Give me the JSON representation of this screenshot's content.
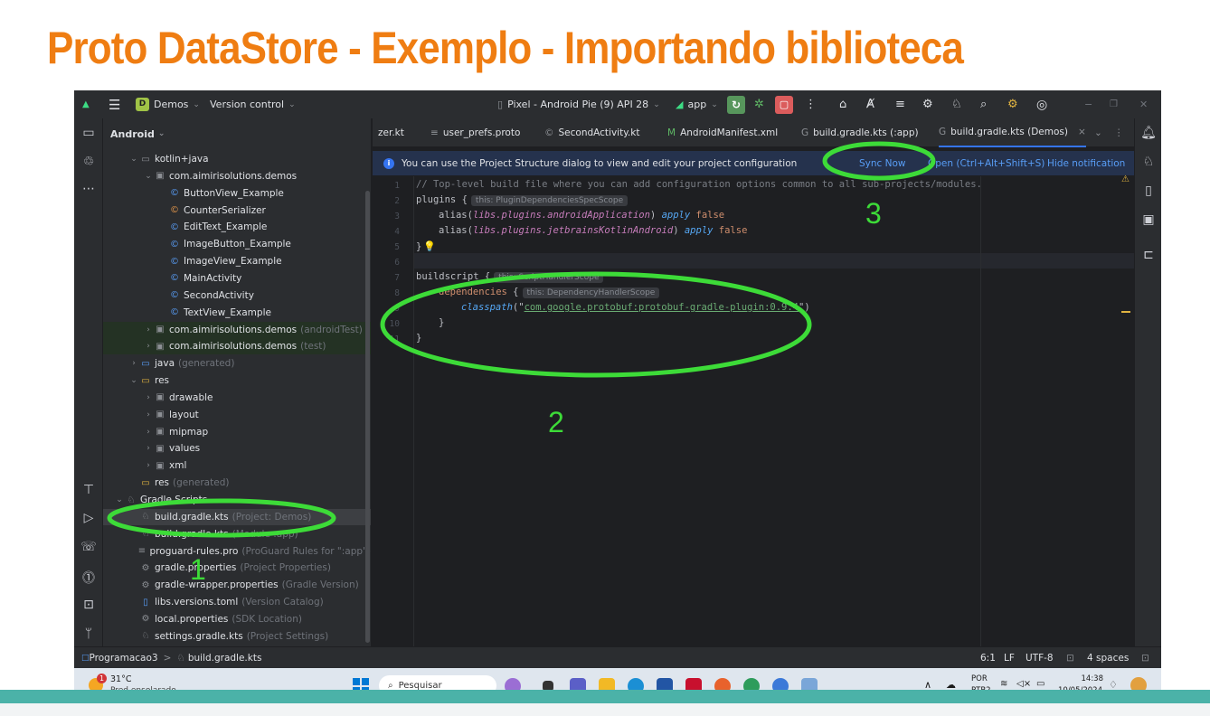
{
  "slide": {
    "title": "Proto DataStore - Exemplo - Importando biblioteca"
  },
  "titlebar": {
    "project_badge": "D",
    "project_name": "Demos",
    "version_control": "Version control",
    "device": "Pixel - Android Pie (9) API 28",
    "run_config": "app"
  },
  "project_panel": {
    "view_mode": "Android",
    "items": [
      {
        "arrow": "⌄",
        "icon": "folder",
        "label": "kotlin+java",
        "suffix": ""
      },
      {
        "arrow": "⌄",
        "icon": "package",
        "label": "com.aimirisolutions.demos",
        "suffix": ""
      },
      {
        "arrow": "",
        "icon": "class",
        "label": "ButtonView_Example",
        "suffix": ""
      },
      {
        "arrow": "",
        "icon": "class-orange",
        "label": "CounterSerializer",
        "suffix": ""
      },
      {
        "arrow": "",
        "icon": "class",
        "label": "EditText_Example",
        "suffix": ""
      },
      {
        "arrow": "",
        "icon": "class",
        "label": "ImageButton_Example",
        "suffix": ""
      },
      {
        "arrow": "",
        "icon": "class",
        "label": "ImageView_Example",
        "suffix": ""
      },
      {
        "arrow": "",
        "icon": "class",
        "label": "MainActivity",
        "suffix": ""
      },
      {
        "arrow": "",
        "icon": "class",
        "label": "SecondActivity",
        "suffix": ""
      },
      {
        "arrow": "",
        "icon": "class",
        "label": "TextView_Example",
        "suffix": ""
      },
      {
        "arrow": "›",
        "icon": "package",
        "label": "com.aimirisolutions.demos",
        "suffix": "(androidTest)"
      },
      {
        "arrow": "›",
        "icon": "package",
        "label": "com.aimirisolutions.demos",
        "suffix": "(test)"
      },
      {
        "arrow": "›",
        "icon": "folder-gen",
        "label": "java",
        "suffix": "(generated)"
      },
      {
        "arrow": "⌄",
        "icon": "folder-res",
        "label": "res",
        "suffix": ""
      },
      {
        "arrow": "›",
        "icon": "package",
        "label": "drawable",
        "suffix": ""
      },
      {
        "arrow": "›",
        "icon": "package",
        "label": "layout",
        "suffix": ""
      },
      {
        "arrow": "›",
        "icon": "package",
        "label": "mipmap",
        "suffix": ""
      },
      {
        "arrow": "›",
        "icon": "package",
        "label": "values",
        "suffix": ""
      },
      {
        "arrow": "›",
        "icon": "package",
        "label": "xml",
        "suffix": ""
      },
      {
        "arrow": "",
        "icon": "folder-res",
        "label": "res",
        "suffix": "(generated)"
      },
      {
        "arrow": "⌄",
        "icon": "gradle",
        "label": "Gradle Scripts",
        "suffix": ""
      },
      {
        "arrow": "",
        "icon": "gradle",
        "label": "build.gradle.kts",
        "suffix": "(Project: Demos)"
      },
      {
        "arrow": "",
        "icon": "gradle",
        "label": "build.gradle.kts",
        "suffix": "(Module :app)"
      },
      {
        "arrow": "",
        "icon": "text",
        "label": "proguard-rules.pro",
        "suffix": "(ProGuard Rules for \":app\")"
      },
      {
        "arrow": "",
        "icon": "settings",
        "label": "gradle.properties",
        "suffix": "(Project Properties)"
      },
      {
        "arrow": "",
        "icon": "settings",
        "label": "gradle-wrapper.properties",
        "suffix": "(Gradle Version)"
      },
      {
        "arrow": "",
        "icon": "toml",
        "label": "libs.versions.toml",
        "suffix": "(Version Catalog)"
      },
      {
        "arrow": "",
        "icon": "settings",
        "label": "local.properties",
        "suffix": "(SDK Location)"
      },
      {
        "arrow": "",
        "icon": "gradle",
        "label": "settings.gradle.kts",
        "suffix": "(Project Settings)"
      }
    ]
  },
  "tabs": [
    {
      "label": "zer.kt",
      "icon": ""
    },
    {
      "label": "user_prefs.proto",
      "icon": "≡"
    },
    {
      "label": "SecondActivity.kt",
      "icon": "©"
    },
    {
      "label": "AndroidManifest.xml",
      "icon": "M"
    },
    {
      "label": "build.gradle.kts (:app)",
      "icon": "G"
    },
    {
      "label": "build.gradle.kts (Demos)",
      "icon": "G",
      "active": true
    }
  ],
  "notification": {
    "message": "You can use the Project Structure dialog to view and edit your project configuration",
    "sync": "Sync Now",
    "open": "Open (Ctrl+Alt+Shift+S)",
    "hide": "Hide notification"
  },
  "code": {
    "line_numbers": [
      "1",
      "2",
      "3",
      "4",
      "5",
      "6",
      "7",
      "8",
      "9",
      "10",
      "11"
    ],
    "l1": "// Top-level build file where you can add configuration options common to all sub-projects/modules.",
    "l2_kw": "plugins",
    "l2_brace": " {",
    "l2_hint": "this: PluginDependenciesSpecScope",
    "l3_a": "alias(",
    "l3_b": "libs.plugins.androidApplication",
    "l3_c": ") ",
    "l3_d": "apply",
    "l3_e": " false",
    "l4_a": "alias(",
    "l4_b": "libs.plugins.jetbrainsKotlinAndroid",
    "l4_c": ") ",
    "l4_d": "apply",
    "l4_e": " false",
    "l5": "}",
    "l7_kw": "buildscript",
    "l7_brace": " {",
    "l7_hint": "this: ScriptHandlerScope",
    "l8_kw": "dependencies",
    "l8_brace": " {",
    "l8_hint": "this: DependencyHandlerScope",
    "l9_fn": "classpath",
    "l9_open": "(\"",
    "l9_str": "com.google.protobuf:protobuf-gradle-plugin:0.9.4",
    "l9_close": "\")",
    "l10": "}",
    "l11": "}"
  },
  "statusbar": {
    "breadcrumb_root": "Programacao3",
    "breadcrumb_sep": ">",
    "breadcrumb_file": "build.gradle.kts",
    "position": "6:1",
    "line_sep": "LF",
    "encoding": "UTF-8",
    "indent": "4 spaces"
  },
  "taskbar": {
    "temp": "31°C",
    "weather": "Pred ensolarado",
    "weather_badge": "1",
    "search": "Pesquisar",
    "lang1": "POR",
    "lang2": "PTB2",
    "time": "14:38",
    "date": "10/05/2024"
  },
  "annotations": {
    "n1": "1",
    "n2": "2",
    "n3": "3",
    "color": "#3ddb38"
  },
  "colors": {
    "title": "#ef7d12",
    "accent": "#3574f0",
    "teal": "#4bb2a8"
  }
}
